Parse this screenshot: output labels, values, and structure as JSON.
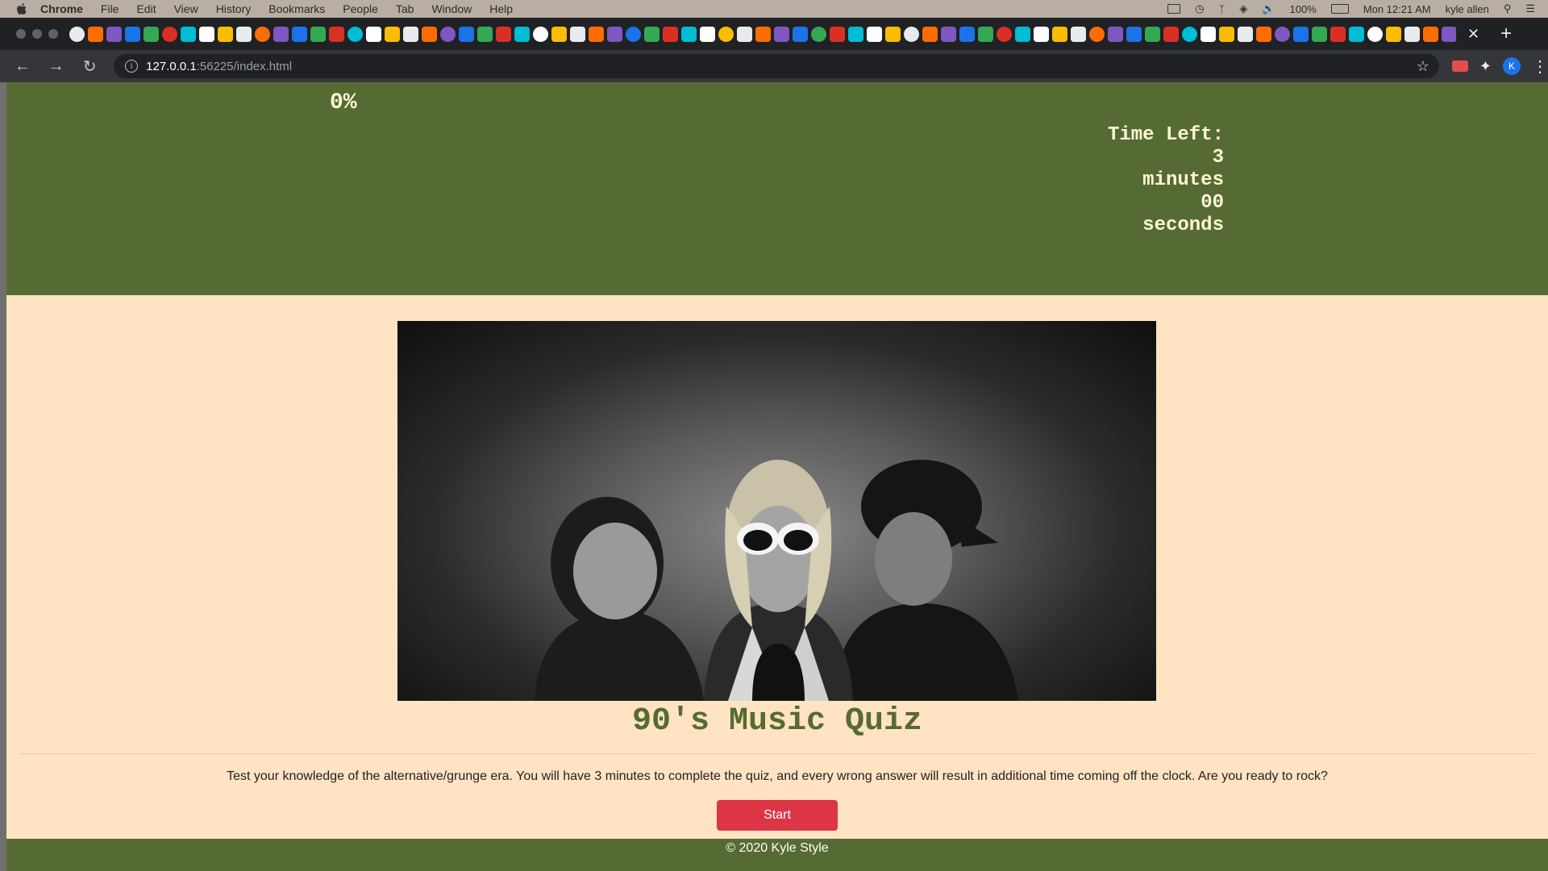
{
  "menubar": {
    "app": "Chrome",
    "items": [
      "File",
      "Edit",
      "View",
      "History",
      "Bookmarks",
      "People",
      "Tab",
      "Window",
      "Help"
    ],
    "battery": "100%",
    "clock": "Mon 12:21 AM",
    "user": "kyle allen"
  },
  "browser": {
    "url_host": "127.0.0.1",
    "url_path": ":56225/index.html",
    "profile_initial": "K"
  },
  "quiz": {
    "progress": "0%",
    "timer": {
      "label": "Time Left:",
      "minutes": "3",
      "minutes_unit": "minutes",
      "seconds": "00",
      "seconds_unit": "seconds"
    },
    "title": "90's Music Quiz",
    "intro": "Test your knowledge of the alternative/grunge era. You will have 3 minutes to complete the quiz, and every wrong answer will result in additional time coming off the clock. Are you ready to rock?",
    "start_label": "Start"
  },
  "footer": {
    "text": "© 2020 Kyle Style"
  },
  "colors": {
    "header_bg": "#556b33",
    "page_bg": "#ffe3c3",
    "button_bg": "#dc3545"
  }
}
